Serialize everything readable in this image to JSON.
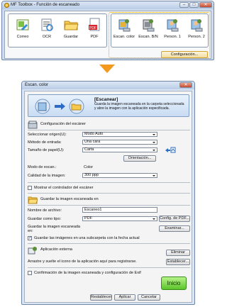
{
  "toolbox": {
    "title": "MF Toolbox - Función de escaneado",
    "tools_left": [
      {
        "label": "Correo",
        "icon": "mail-icon"
      },
      {
        "label": "OCR",
        "icon": "ocr-icon"
      },
      {
        "label": "Guardar",
        "icon": "folder-icon"
      },
      {
        "label": "PDF",
        "icon": "pdf-icon"
      }
    ],
    "tools_right": [
      {
        "label": "Escan. color",
        "icon": "scanner-color-icon"
      },
      {
        "label": "Escan. B/N",
        "icon": "scanner-bw-icon"
      },
      {
        "label": "Person. 1",
        "icon": "scanner-custom1-icon"
      },
      {
        "label": "Person. 2",
        "icon": "scanner-custom2-icon"
      }
    ],
    "config_button": "Configuración..."
  },
  "dialog": {
    "title": "Escan. color",
    "banner": {
      "title": "[Escanear]",
      "description": "Guarda la imagen escaneada en la carpeta seleccionada y abre la imagen con la aplicación especificada."
    },
    "scanner_section": {
      "heading": "Configuración del escáner",
      "source_label": "Seleccionar origen(U):",
      "source_value": "Modo Auto",
      "input_method_label": "Método de entrada:",
      "input_method_value": "Una cara",
      "paper_size_label": "Tamaño de papel(U):",
      "paper_size_value": "Carta",
      "orientation_button": "Orientación...",
      "scan_mode_label": "Modo de escan.:",
      "scan_mode_value": "Color",
      "quality_label": "Calidad de la imagen:",
      "quality_value": "300 ppp",
      "show_driver_label": "Mostrar el controlador del escáner"
    },
    "save_section": {
      "heading": "Guardar la imagen escaneada en",
      "filename_label": "Nombre de archivo:",
      "filename_value": "Escaneo1",
      "save_type_label": "Guardar como tipo:",
      "save_type_value": "PDF",
      "pdf_config_button": "Config. de PDF...",
      "save_location_label": "Guardar la imagen escaneada en:",
      "browse_button": "Examinar...",
      "subfolder_label": "Guardar las imágenes en una subcarpeta con la fecha actual"
    },
    "external_app": {
      "heading": "Aplicación externa",
      "remove_button": "Eliminar",
      "hint": "Arrastre y suelte el icono de la aplicación aquí para registrarse.",
      "set_button": "Establecer..."
    },
    "confirm_label": "Confirmación de la imagen escaneada y configuración de Exif",
    "buttons": {
      "reset": "Restablecer",
      "apply": "Aplicar",
      "cancel": "Cancelar",
      "start": "Inicio"
    }
  }
}
